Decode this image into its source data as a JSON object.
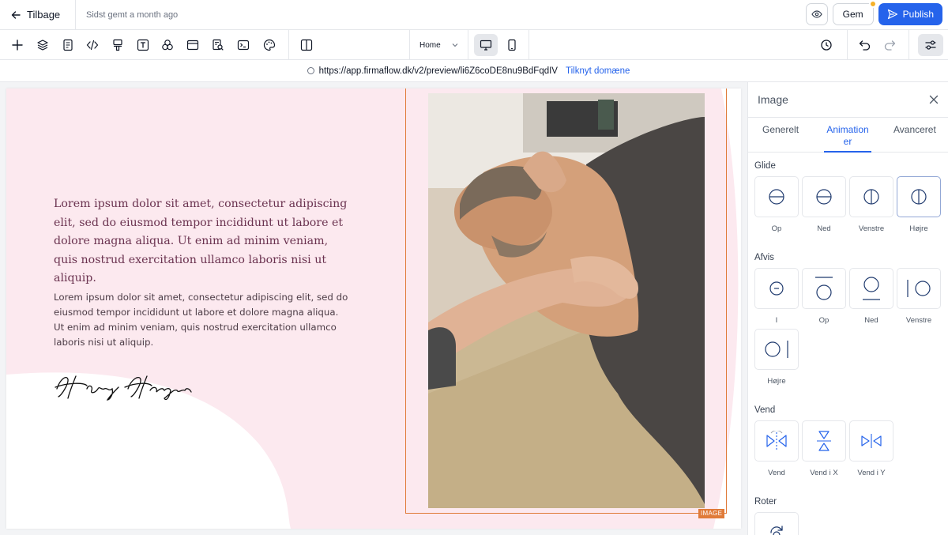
{
  "topbar": {
    "back_label": "Tilbage",
    "saved_status": "Sidst gemt a month ago",
    "save_label": "Gem",
    "publish_label": "Publish"
  },
  "toolbar": {
    "page_select_value": "Home",
    "tools": [
      "plus-icon",
      "layers-icon",
      "page-icon",
      "code-icon",
      "brush-icon",
      "text-icon",
      "components-icon",
      "layout-icon",
      "seo-icon",
      "terminal-icon",
      "palette-icon",
      "split-view-icon"
    ]
  },
  "urlbar": {
    "url": "https://app.firmaflow.dk/v2/preview/li6Z6coDE8nu9BdFqdIV",
    "link_label": "Tilknyt domæne"
  },
  "canvas": {
    "paragraph_large": "Lorem ipsum dolor sit amet, consectetur adipiscing elit, sed do eiusmod tempor incididunt ut labore et dolore magna aliqua. Ut enim ad minim veniam, quis nostrud exercitation ullamco laboris nisi ut aliquip.",
    "paragraph_small": "Lorem ipsum dolor sit amet, consectetur adipiscing elit, sed do eiusmod tempor incididunt ut labore et dolore magna aliqua. Ut enim ad minim veniam, quis nostrud exercitation ullamco laboris nisi ut aliquip.",
    "signature": "Henry Hampton",
    "image_badge": "IMAGE"
  },
  "panel": {
    "title": "Image",
    "tabs": [
      {
        "label": "Generelt"
      },
      {
        "label_line1": "Animation",
        "label_line2": "er"
      },
      {
        "label": "Avanceret"
      }
    ],
    "sections": {
      "glide": {
        "label": "Glide",
        "items": [
          "Op",
          "Ned",
          "Venstre",
          "Højre"
        ]
      },
      "afvis": {
        "label": "Afvis",
        "items": [
          "I",
          "Op",
          "Ned",
          "Venstre",
          "Højre"
        ]
      },
      "vend": {
        "label": "Vend",
        "items": [
          "Vend",
          "Vend i X",
          "Vend i Y"
        ]
      },
      "roter": {
        "label": "Roter"
      }
    },
    "selected_item": "Højre"
  },
  "colors": {
    "accent": "#2563eb",
    "canvas_bg": "#fce9ef",
    "frame": "#e07b39",
    "heading_text": "#6b3350"
  }
}
